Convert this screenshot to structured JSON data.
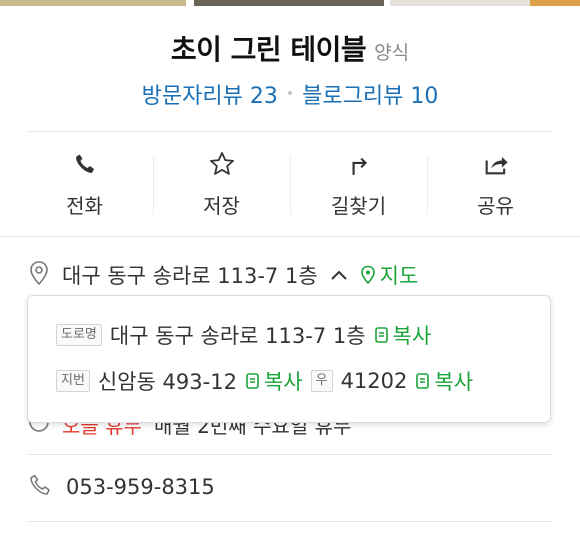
{
  "photo_strip_colors": [
    "#c8b98a",
    "#d7d2bd",
    "#6b6258",
    "#e6e1d8",
    "#e0a14b"
  ],
  "place": {
    "name": "초이 그린 테이블",
    "category": "양식"
  },
  "reviews": {
    "visit_label": "방문자리뷰",
    "visit_count": "23",
    "blog_label": "블로그리뷰",
    "blog_count": "10"
  },
  "actions": [
    {
      "label": "전화",
      "icon": "phone-icon"
    },
    {
      "label": "저장",
      "icon": "star-icon"
    },
    {
      "label": "길찾기",
      "icon": "directions-icon"
    },
    {
      "label": "공유",
      "icon": "share-icon"
    }
  ],
  "address": {
    "text": "대구 동구 송라로 113-7 1층",
    "map_label": "지도"
  },
  "address_popup": {
    "road_tag": "도로명",
    "road_address": "대구 동구 송라로 113-7 1층",
    "lot_tag": "지번",
    "lot_address": "신암동 493-12",
    "zip_tag": "우",
    "zip_code": "41202",
    "copy_label": "복사"
  },
  "hidden_row": {
    "red_text": "오늘 휴무",
    "rest_text": "매월 2번째 수요일 휴무"
  },
  "phone": "053-959-8315",
  "colors": {
    "accent_blue": "#1a6fb5",
    "accent_green": "#1ba43a",
    "red": "#e23b2e"
  }
}
